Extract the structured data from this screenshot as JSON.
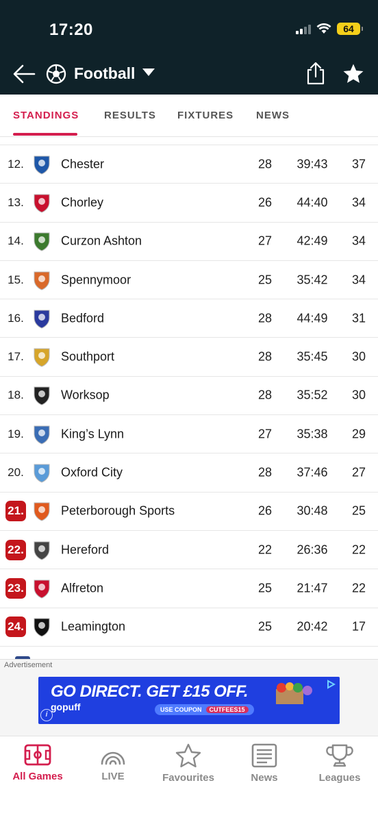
{
  "status_bar": {
    "time": "17:20",
    "battery": "64"
  },
  "header": {
    "title": "Football",
    "sport_icon": "football-icon"
  },
  "tabs": [
    {
      "label": "STANDINGS",
      "active": true
    },
    {
      "label": "RESULTS",
      "active": false
    },
    {
      "label": "FIXTURES",
      "active": false
    },
    {
      "label": "NEWS",
      "active": false
    }
  ],
  "standings": [
    {
      "pos": "12.",
      "team": "Chester",
      "played": "28",
      "goals": "39:43",
      "points": "37",
      "relegation": false
    },
    {
      "pos": "13.",
      "team": "Chorley",
      "played": "26",
      "goals": "44:40",
      "points": "34",
      "relegation": false
    },
    {
      "pos": "14.",
      "team": "Curzon Ashton",
      "played": "27",
      "goals": "42:49",
      "points": "34",
      "relegation": false
    },
    {
      "pos": "15.",
      "team": "Spennymoor",
      "played": "25",
      "goals": "35:42",
      "points": "34",
      "relegation": false
    },
    {
      "pos": "16.",
      "team": "Bedford",
      "played": "28",
      "goals": "44:49",
      "points": "31",
      "relegation": false
    },
    {
      "pos": "17.",
      "team": "Southport",
      "played": "28",
      "goals": "35:45",
      "points": "30",
      "relegation": false
    },
    {
      "pos": "18.",
      "team": "Worksop",
      "played": "28",
      "goals": "35:52",
      "points": "30",
      "relegation": false
    },
    {
      "pos": "19.",
      "team": "King’s Lynn",
      "played": "27",
      "goals": "35:38",
      "points": "29",
      "relegation": false
    },
    {
      "pos": "20.",
      "team": "Oxford City",
      "played": "28",
      "goals": "37:46",
      "points": "27",
      "relegation": false
    },
    {
      "pos": "21.",
      "team": "Peterborough Sports",
      "played": "26",
      "goals": "30:48",
      "points": "25",
      "relegation": true
    },
    {
      "pos": "22.",
      "team": "Hereford",
      "played": "22",
      "goals": "26:36",
      "points": "22",
      "relegation": true
    },
    {
      "pos": "23.",
      "team": "Alfreton",
      "played": "25",
      "goals": "21:47",
      "points": "22",
      "relegation": true
    },
    {
      "pos": "24.",
      "team": "Leamington",
      "played": "25",
      "goals": "20:42",
      "points": "17",
      "relegation": true
    }
  ],
  "ad": {
    "label": "Advertisement",
    "headline": "GO DIRECT. GET £15 OFF.",
    "brand": "gopuff",
    "coupon_label": "USE COUPON",
    "coupon_code": "CUTFEES15"
  },
  "bottom_nav": [
    {
      "label": "All Games",
      "icon": "pitch-icon",
      "active": true
    },
    {
      "label": "LIVE",
      "icon": "live-icon",
      "active": false
    },
    {
      "label": "Favourites",
      "icon": "star-icon",
      "active": false
    },
    {
      "label": "News",
      "icon": "newspaper-icon",
      "active": false
    },
    {
      "label": "Leagues",
      "icon": "trophy-icon",
      "active": false
    }
  ],
  "colors": {
    "header_bg": "#0f2229",
    "accent": "#d41e4e",
    "relegation": "#c4161c",
    "ad_bg": "#1f3fe0"
  }
}
